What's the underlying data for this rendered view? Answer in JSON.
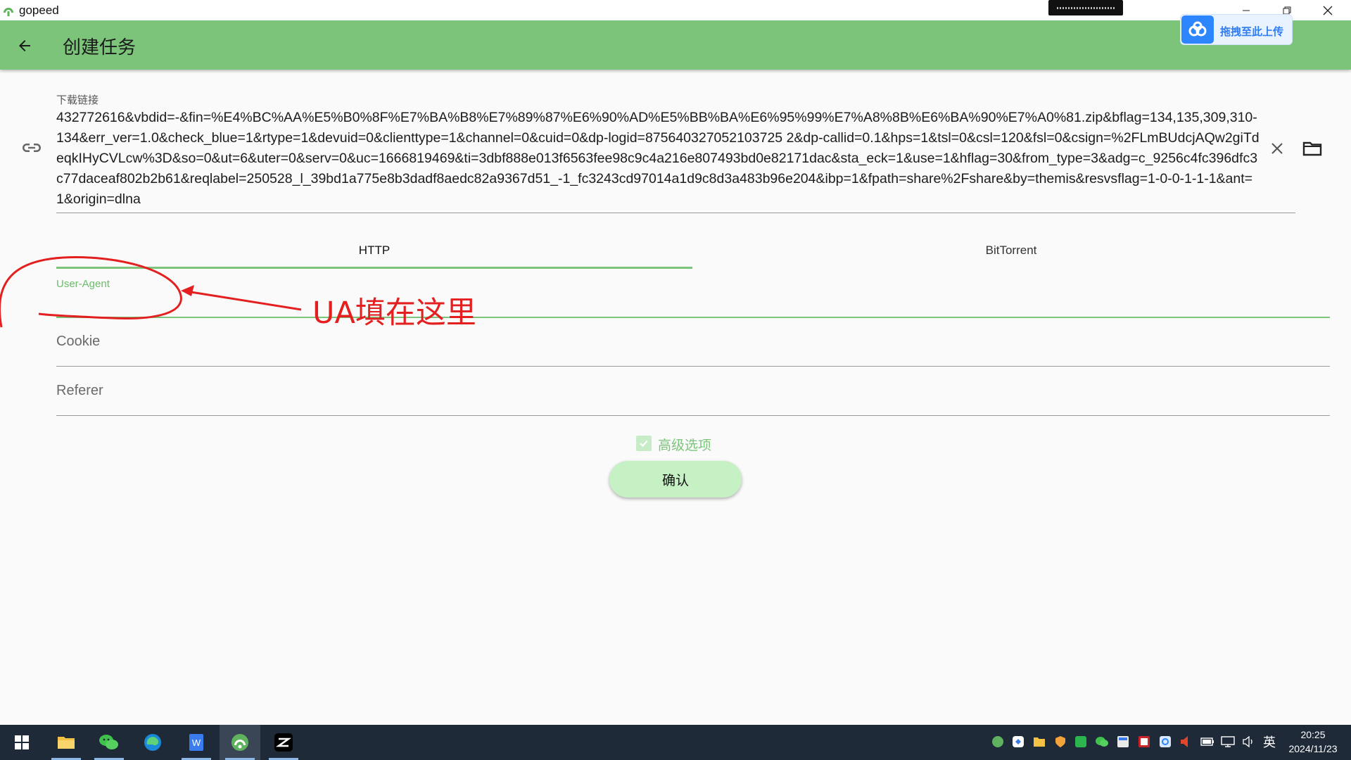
{
  "window": {
    "title": "gopeed",
    "controls": [
      "minimize-icon",
      "restore-icon",
      "close-icon"
    ]
  },
  "appbar": {
    "title": "创建任务",
    "back_icon": "arrow-left-icon"
  },
  "baidu_widget": {
    "label": "拖拽至此上传",
    "icon": "baidu-cloud-icon"
  },
  "url_field": {
    "label": "下载链接",
    "value": "432772616&vbdid=-&fin=%E4%BC%AA%E5%B0%8F%E7%BA%B8%E7%89%87%E6%90%AD%E5%BB%BA%E6%95%99%E7%A8%8B%E6%BA%90%E7%A0%81.zip&bflag=134,135,309,310-134&err_ver=1.0&check_blue=1&rtype=1&devuid=0&clienttype=1&channel=0&cuid=0&dp-logid=875640327052103725 2&dp-callid=0.1&hps=1&tsl=0&csl=120&fsl=0&csign=%2FLmBUdcjAQw2giTdeqkIHyCVLcw%3D&so=0&ut=6&uter=0&serv=0&uc=1666819469&ti=3dbf888e013f6563fee98c9c4a216e807493bd0e82171dac&sta_eck=1&use=1&hflag=30&from_type=3&adg=c_9256c4fc396dfc3c77daceaf802b2b61&reqlabel=250528_l_39bd1a775e8b3dadf8aedc82a9367d51_-1_fc3243cd97014a1d9c8d3a483b96e204&ibp=1&fpath=share%2Fshare&by=themis&resvsflag=1-0-0-1-1-1&ant=1&origin=dlna",
    "link_icon": "link-icon",
    "clear_icon": "close-icon",
    "folder_icon": "folder-icon"
  },
  "tabs": [
    {
      "label": "HTTP",
      "active": true
    },
    {
      "label": "BitTorrent",
      "active": false
    }
  ],
  "http_form": {
    "user_agent_label": "User-Agent",
    "user_agent_value": "",
    "cookie_placeholder": "Cookie",
    "referer_placeholder": "Referer"
  },
  "advanced": {
    "label": "高级选项",
    "checked": true
  },
  "confirm_label": "确认",
  "annotation": {
    "text": "UA填在这里",
    "color": "#e3201f"
  },
  "taskbar": {
    "apps": [
      "windows-start-icon",
      "file-explorer-icon",
      "wechat-icon",
      "edge-icon",
      "wps-writer-icon",
      "gopeed-icon",
      "capcut-icon"
    ],
    "tray_icons": [
      "gopeed-tray-icon",
      "app-tray-icon",
      "folder-tray-icon",
      "shield-tray-icon",
      "green-app-tray-icon",
      "wechat-tray-icon",
      "calculator-tray-icon",
      "red-app-tray-icon",
      "baidu-tray-icon",
      "speaker-red-tray-icon",
      "battery-tray-icon",
      "network-tray-icon",
      "volume-tray-icon"
    ],
    "language": "英",
    "time": "20:25",
    "date": "2024/11/23"
  },
  "colors": {
    "appbar": "#7bc47a",
    "accent": "#7bc47a",
    "confirm_bg": "#c6f1c4",
    "taskbar": "#1f2a38"
  }
}
